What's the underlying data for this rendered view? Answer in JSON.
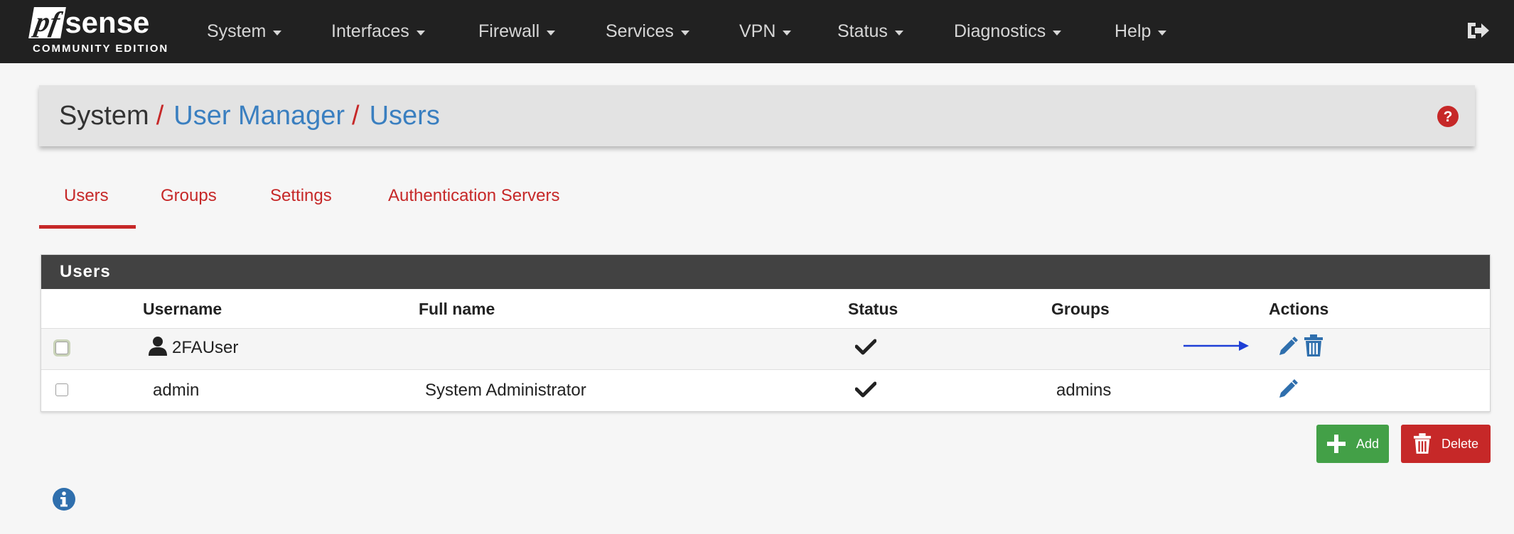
{
  "logo": {
    "main_pf": "pf",
    "main_sense": "sense",
    "subtitle": "COMMUNITY EDITION"
  },
  "nav": {
    "items": [
      {
        "label": "System"
      },
      {
        "label": "Interfaces"
      },
      {
        "label": "Firewall"
      },
      {
        "label": "Services"
      },
      {
        "label": "VPN"
      },
      {
        "label": "Status"
      },
      {
        "label": "Diagnostics"
      },
      {
        "label": "Help"
      }
    ],
    "logout_icon": "sign-out-icon"
  },
  "breadcrumb": {
    "root": "System",
    "separator": "/",
    "items": [
      "User Manager",
      "Users"
    ],
    "help_icon": "question-circle-icon"
  },
  "tabs": [
    {
      "label": "Users",
      "active": true
    },
    {
      "label": "Groups",
      "active": false
    },
    {
      "label": "Settings",
      "active": false
    },
    {
      "label": "Authentication Servers",
      "active": false
    }
  ],
  "users_panel": {
    "title": "Users",
    "columns": [
      "Username",
      "Full name",
      "Status",
      "Groups",
      "Actions"
    ],
    "rows": [
      {
        "username": "2FAUser",
        "full_name": "",
        "status": "enabled",
        "groups": "",
        "system_user": false,
        "actions": [
          "edit",
          "delete"
        ]
      },
      {
        "username": "admin",
        "full_name": "System Administrator",
        "status": "enabled",
        "groups": "admins",
        "system_user": true,
        "actions": [
          "edit"
        ]
      }
    ]
  },
  "buttons": {
    "add_label": "Add",
    "delete_label": "Delete"
  },
  "colors": {
    "navbar": "#212121",
    "accent_red": "#c62828",
    "link_blue": "#3a7fc0",
    "add_green": "#43a047",
    "annotation_arrow": "#1e3fd6"
  }
}
